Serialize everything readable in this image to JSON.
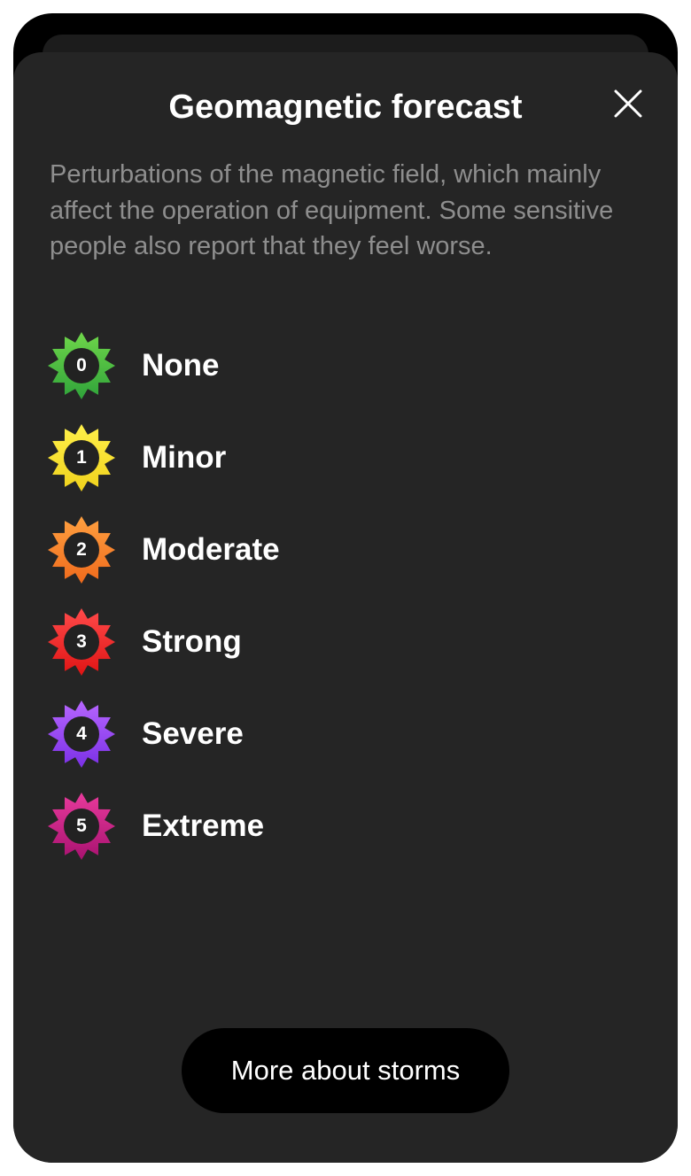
{
  "sheet": {
    "title": "Geomagnetic forecast",
    "close_icon": "close-icon",
    "description": "Perturbations of the magnetic field, which mainly affect the operation of equipment. Some sensitive people also report that they feel worse."
  },
  "levels": [
    {
      "number": "0",
      "label": "None",
      "color_light": "#6fd64a",
      "color_dark": "#2fa33a",
      "icon": "sun-badge-icon"
    },
    {
      "number": "1",
      "label": "Minor",
      "color_light": "#fff04a",
      "color_dark": "#f0d21c",
      "icon": "sun-badge-icon"
    },
    {
      "number": "2",
      "label": "Moderate",
      "color_light": "#ffa040",
      "color_dark": "#ef6a1c",
      "icon": "sun-badge-icon"
    },
    {
      "number": "3",
      "label": "Strong",
      "color_light": "#ff4a4a",
      "color_dark": "#e01414",
      "icon": "sun-badge-icon"
    },
    {
      "number": "4",
      "label": "Severe",
      "color_light": "#b766ff",
      "color_dark": "#7a30e6",
      "icon": "sun-badge-icon"
    },
    {
      "number": "5",
      "label": "Extreme",
      "color_light": "#e83a9c",
      "color_dark": "#a81270",
      "icon": "sun-badge-icon"
    }
  ],
  "footer": {
    "more_button_label": "More about storms"
  },
  "colors": {
    "sheet_background": "#252525",
    "description_text": "#8e8e8e",
    "badge_center": "#222222"
  }
}
